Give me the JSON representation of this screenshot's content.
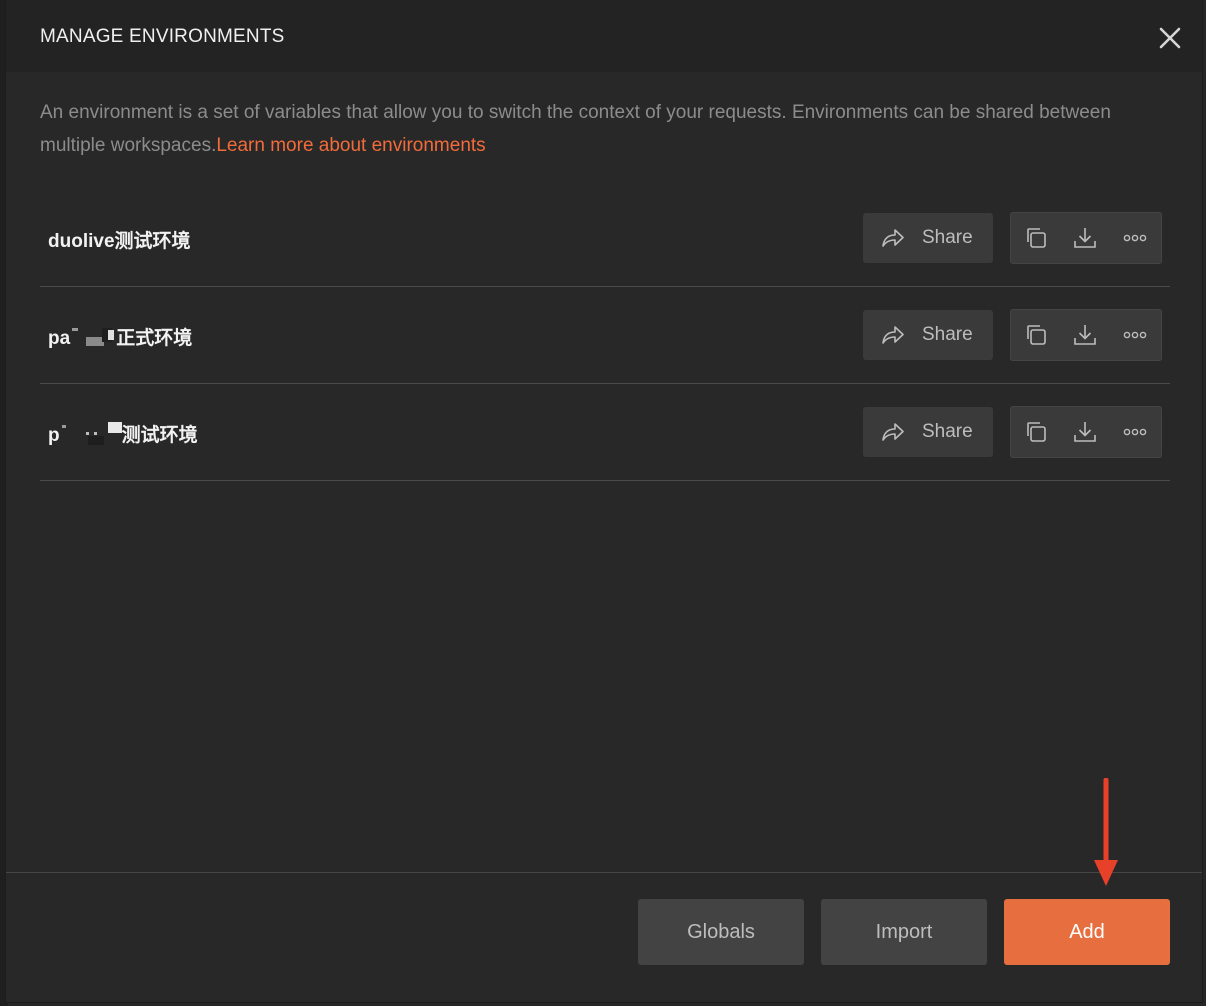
{
  "modal": {
    "title": "MANAGE ENVIRONMENTS",
    "close_icon": "close-icon",
    "description": "An environment is a set of variables that allow you to switch the context of your requests. Environments can be shared between multiple workspaces.",
    "learn_more_link": "Learn more about environments"
  },
  "environments": [
    {
      "name": "duolive测试环境",
      "share_label": "Share"
    },
    {
      "name_prefix": "pa",
      "name_suffix": "正式环境",
      "share_label": "Share"
    },
    {
      "name_prefix": "p",
      "name_suffix": "测试环境",
      "share_label": "Share"
    }
  ],
  "row_actions": {
    "copy_icon": "copy-icon",
    "download_icon": "download-icon",
    "more_icon": "more-icon",
    "share_icon": "share-icon"
  },
  "footer": {
    "globals_label": "Globals",
    "import_label": "Import",
    "add_label": "Add"
  },
  "colors": {
    "accent": "#e76f3f",
    "link": "#f26b3a",
    "annotation_arrow": "#e8412a"
  }
}
